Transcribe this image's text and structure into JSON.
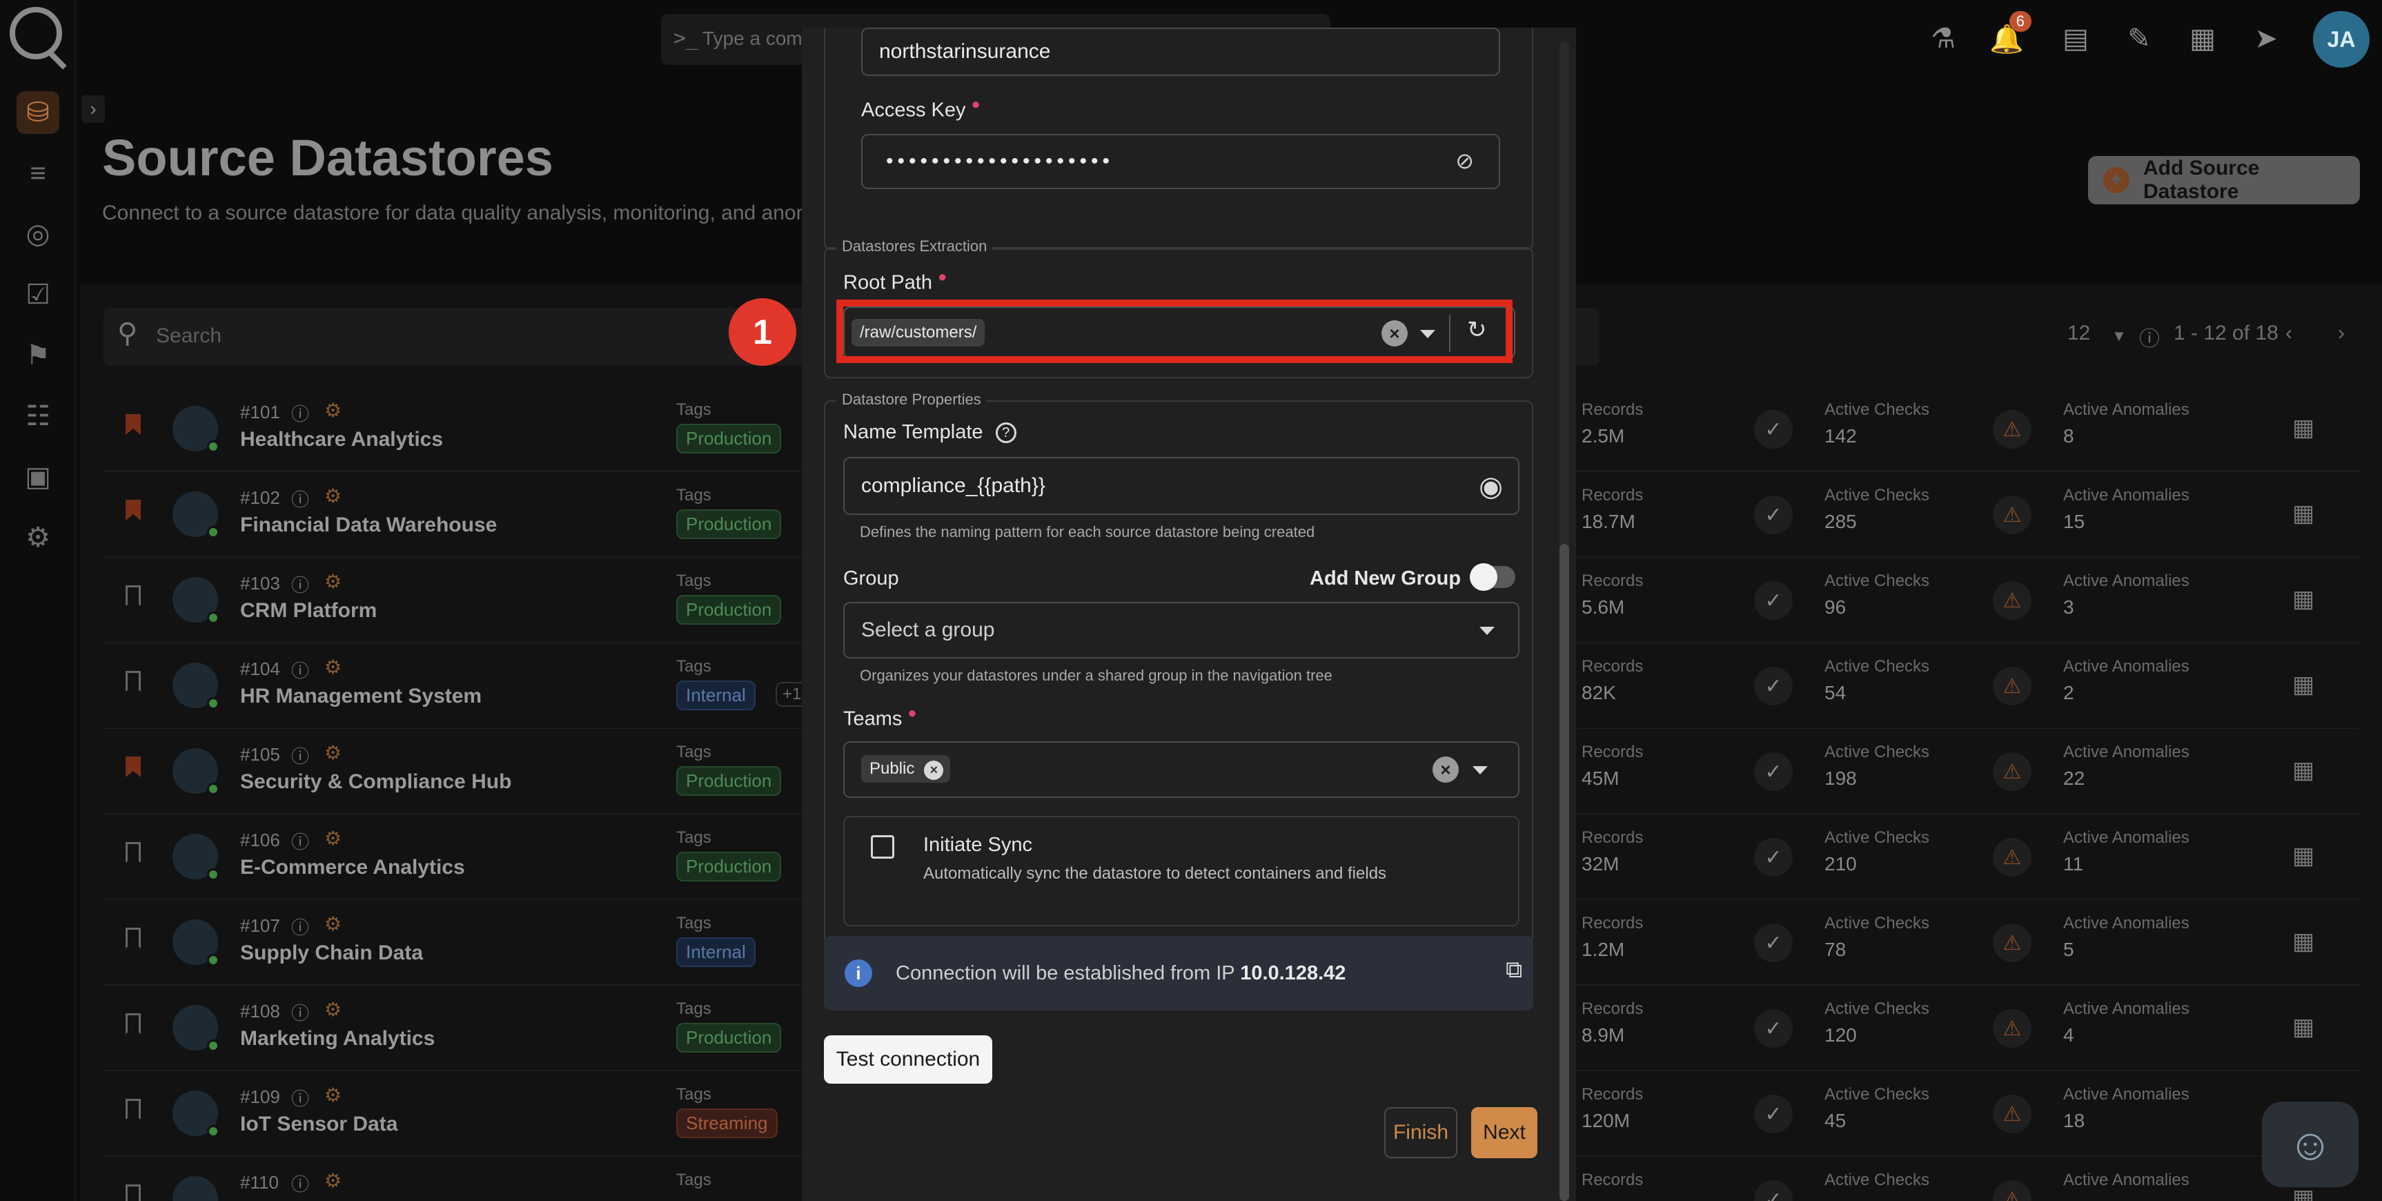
{
  "header": {
    "command_placeholder": "Type a comm",
    "notification_count": "6",
    "avatar_initials": "JA"
  },
  "page": {
    "title": "Source Datastores",
    "subtitle": "Connect to a source datastore for data quality analysis, monitoring, and anomal",
    "add_button": "Add Source Datastore",
    "search_placeholder": "Search",
    "page_size": "12",
    "page_range": "1 - 12 of 18"
  },
  "list": {
    "tags_label": "Tags",
    "records_label": "Records",
    "checks_label": "Active Checks",
    "anomalies_label": "Active Anomalies",
    "rows": [
      {
        "id": "#101",
        "name": "Healthcare Analytics",
        "tag": "Production",
        "tag_kind": "prod",
        "records": "2.5M",
        "checks": "142",
        "anomalies": "8",
        "bookmarked": true
      },
      {
        "id": "#102",
        "name": "Financial Data Warehouse",
        "tag": "Production",
        "tag_kind": "prod",
        "records": "18.7M",
        "checks": "285",
        "anomalies": "15",
        "bookmarked": true
      },
      {
        "id": "#103",
        "name": "CRM Platform",
        "tag": "Production",
        "tag_kind": "prod",
        "records": "5.6M",
        "checks": "96",
        "anomalies": "3",
        "bookmarked": false
      },
      {
        "id": "#104",
        "name": "HR Management System",
        "tag": "Internal",
        "tag_kind": "int",
        "extra": "+1",
        "records": "82K",
        "checks": "54",
        "anomalies": "2",
        "bookmarked": false
      },
      {
        "id": "#105",
        "name": "Security & Compliance Hub",
        "tag": "Production",
        "tag_kind": "prod",
        "records": "45M",
        "checks": "198",
        "anomalies": "22",
        "bookmarked": true
      },
      {
        "id": "#106",
        "name": "E-Commerce Analytics",
        "tag": "Production",
        "tag_kind": "prod",
        "records": "32M",
        "checks": "210",
        "anomalies": "11",
        "bookmarked": false
      },
      {
        "id": "#107",
        "name": "Supply Chain Data",
        "tag": "Internal",
        "tag_kind": "int",
        "records": "1.2M",
        "checks": "78",
        "anomalies": "5",
        "bookmarked": false
      },
      {
        "id": "#108",
        "name": "Marketing Analytics",
        "tag": "Production",
        "tag_kind": "prod",
        "records": "8.9M",
        "checks": "120",
        "anomalies": "4",
        "bookmarked": false
      },
      {
        "id": "#109",
        "name": "IoT Sensor Data",
        "tag": "Streaming",
        "tag_kind": "str",
        "records": "120M",
        "checks": "45",
        "anomalies": "18",
        "bookmarked": false
      },
      {
        "id": "#110",
        "name": "",
        "tag": "",
        "tag_kind": "",
        "records": "",
        "checks": "",
        "anomalies": "",
        "bookmarked": false
      }
    ]
  },
  "modal": {
    "account_value": "northstarinsurance",
    "access_key_label": "Access Key",
    "access_key_masked": "••••••••••••••••••••",
    "extraction_legend": "Datastores Extraction",
    "root_path_label": "Root Path",
    "root_path_value": "/raw/customers/",
    "properties_legend": "Datastore Properties",
    "name_template_label": "Name Template",
    "name_template_value": "compliance_{{path}}",
    "name_template_help": "Defines the naming pattern for each source datastore being created",
    "group_label": "Group",
    "add_new_group_label": "Add New Group",
    "group_placeholder": "Select a group",
    "group_help": "Organizes your datastores under a shared group in the navigation tree",
    "teams_label": "Teams",
    "teams_chip": "Public",
    "initiate_sync_label": "Initiate Sync",
    "initiate_sync_help": "Automatically sync the datastore to detect containers and fields",
    "connection_prefix": "Connection will be established from IP ",
    "connection_ip": "10.0.128.42",
    "test_button": "Test connection",
    "finish_button": "Finish",
    "next_button": "Next"
  },
  "annotation": {
    "step_number": "1"
  },
  "colors": {
    "accent": "#d08a4a",
    "highlight": "#e0281b",
    "required": "#e0426a"
  }
}
